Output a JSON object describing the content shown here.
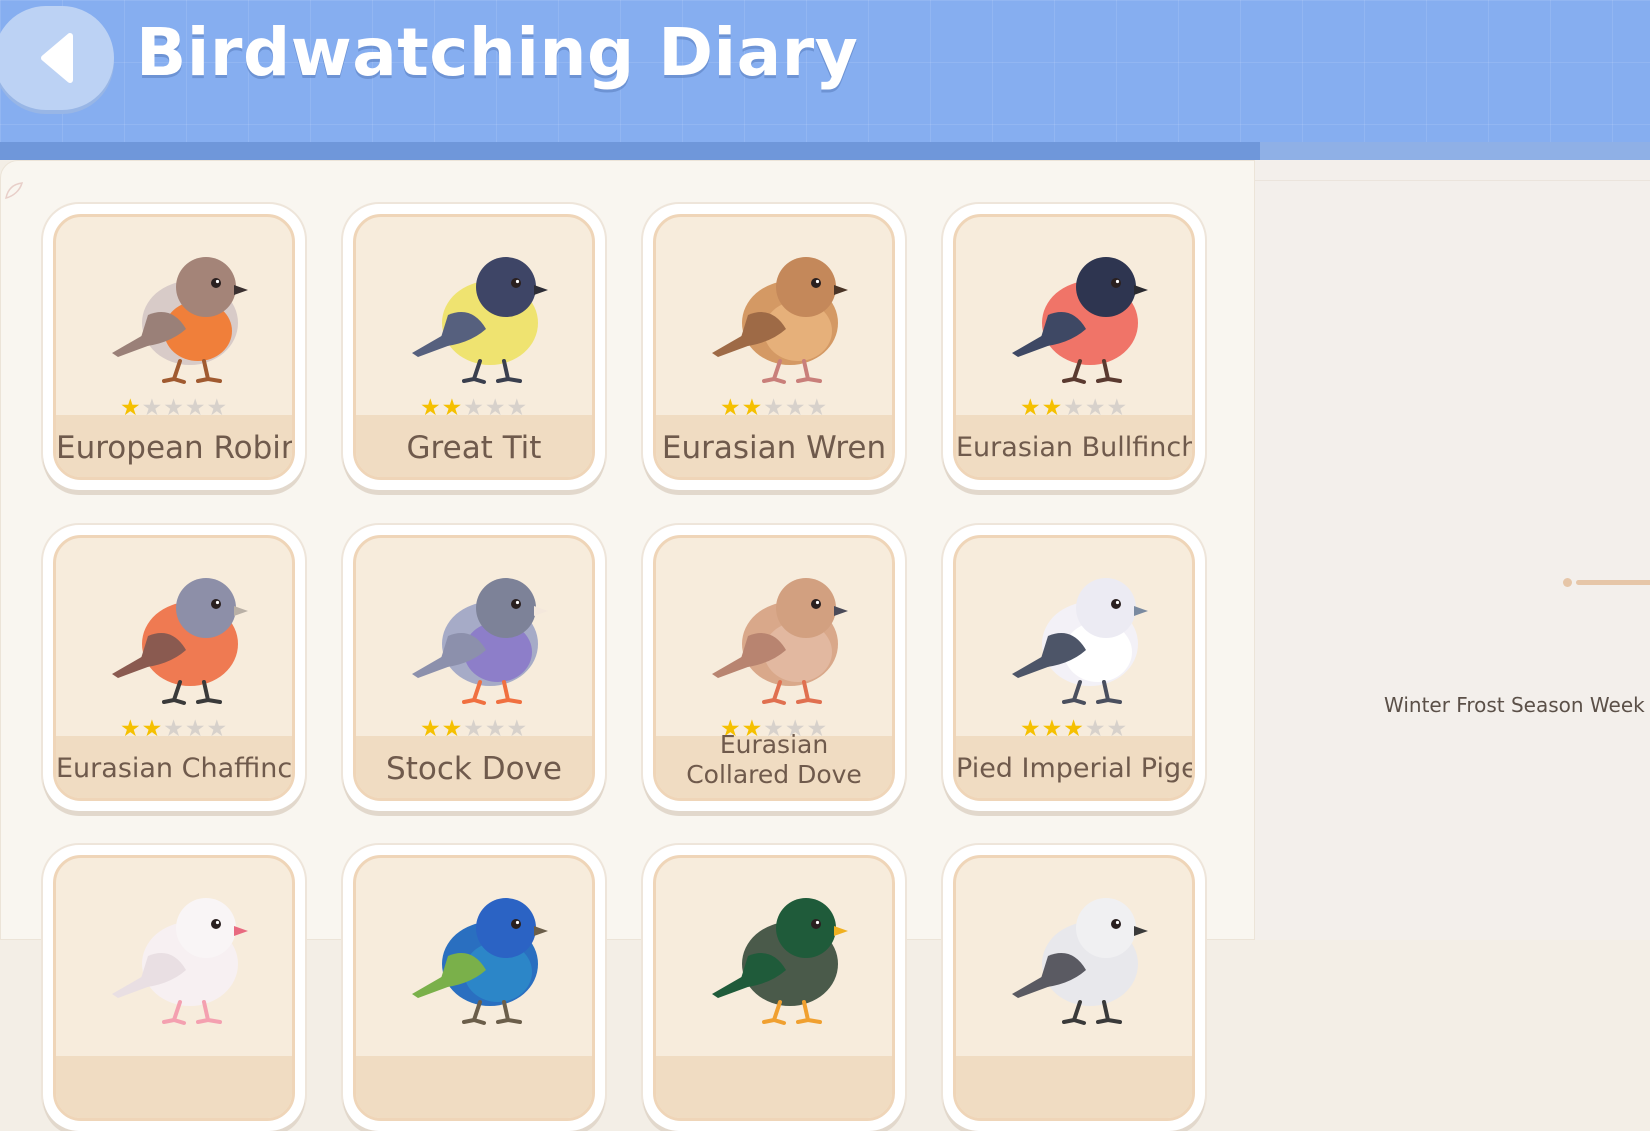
{
  "header": {
    "title": "Birdwatching Diary",
    "back_icon": "chevron-left-icon"
  },
  "side": {
    "season_text": "Winter Frost Season Week"
  },
  "birds": [
    {
      "name": "European Robin",
      "stars": 1,
      "colors": {
        "body": "#d8cbc8",
        "breast": "#f07f3a",
        "wing": "#9a8078",
        "head": "#a48478",
        "beak": "#3a3030",
        "legs": "#a05a30"
      }
    },
    {
      "name": "Great Tit",
      "stars": 2,
      "colors": {
        "body": "#efe370",
        "breast": "#efe370",
        "wing": "#56607e",
        "head": "#3e4566",
        "beak": "#2d2d36",
        "legs": "#3a3f4e"
      }
    },
    {
      "name": "Eurasian Wren",
      "stars": 2,
      "colors": {
        "body": "#d49964",
        "breast": "#e6b07a",
        "wing": "#9e6a46",
        "head": "#c4885a",
        "beak": "#4a3426",
        "legs": "#c97f7a"
      }
    },
    {
      "name": "Eurasian Bullfinch",
      "stars": 2,
      "colors": {
        "body": "#f07468",
        "breast": "#f07468",
        "wing": "#3e4864",
        "head": "#2e3550",
        "beak": "#2a2a30",
        "legs": "#5a3a30"
      }
    },
    {
      "name": "Eurasian Chaffinch",
      "stars": 2,
      "colors": {
        "body": "#ef7a52",
        "breast": "#ef7a52",
        "wing": "#8a5a50",
        "head": "#8d8fa8",
        "beak": "#b9b0a6",
        "legs": "#3a3a3a"
      }
    },
    {
      "name": "Stock Dove",
      "stars": 2,
      "colors": {
        "body": "#a6abc7",
        "breast": "#8d7ec9",
        "wing": "#8c90ac",
        "head": "#7d8298",
        "beak": "#f4e8dc",
        "legs": "#f07040"
      }
    },
    {
      "name": "Eurasian Collared Dove",
      "stars": 2,
      "colors": {
        "body": "#d9a88a",
        "breast": "#e2b8a0",
        "wing": "#b88470",
        "head": "#d2a080",
        "beak": "#4a4a58",
        "legs": "#e07050"
      }
    },
    {
      "name": "Pied Imperial Pigeon",
      "stars": 3,
      "colors": {
        "body": "#f3f1f7",
        "breast": "#ffffff",
        "wing": "#4d5568",
        "head": "#ecebf3",
        "beak": "#7a8aa0",
        "legs": "#4a4f5e"
      }
    },
    {
      "name": "",
      "stars": 0,
      "colors": {
        "body": "#f7f0f2",
        "breast": "#f7f0f2",
        "wing": "#e9dfe3",
        "head": "#f9f5f6",
        "beak": "#e86a80",
        "legs": "#f4a0b0"
      }
    },
    {
      "name": "",
      "stars": 0,
      "colors": {
        "body": "#2a6fc0",
        "breast": "#2c86c8",
        "wing": "#7ab04a",
        "head": "#2b63c4",
        "beak": "#6b5e4a",
        "legs": "#6b5e4a"
      }
    },
    {
      "name": "",
      "stars": 0,
      "colors": {
        "body": "#4a5a4a",
        "breast": "#4a5a4a",
        "wing": "#1f5b3a",
        "head": "#1f5b3a",
        "beak": "#f0b020",
        "legs": "#f0a030"
      }
    },
    {
      "name": "",
      "stars": 0,
      "colors": {
        "body": "#e8e8ec",
        "breast": "#e8e8ec",
        "wing": "#5a5a62",
        "head": "#f0f0f2",
        "beak": "#3a3a3a",
        "legs": "#3a3a3a"
      }
    }
  ]
}
